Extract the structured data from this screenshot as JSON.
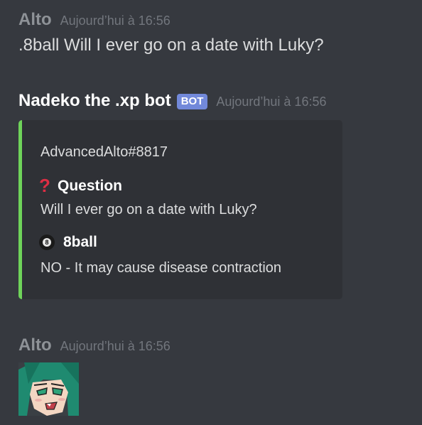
{
  "messages": [
    {
      "author": "Alto",
      "timestamp": "Aujourd’hui à 16:56",
      "text": ".8ball Will I ever go on a date with Luky?"
    },
    {
      "author": "Nadeko the .xp bot",
      "bot_tag": "BOT",
      "timestamp": "Aujourd’hui à 16:56",
      "embed": {
        "author": "AdvancedAlto#8817",
        "accent_color": "#6fd35a",
        "fields": [
          {
            "icon": "question-mark-icon",
            "name": "Question",
            "value": "Will I ever go on a date with Luky?"
          },
          {
            "icon": "8ball-icon",
            "name": "8ball",
            "value": "NO - It may cause disease contraction"
          }
        ]
      }
    },
    {
      "author": "Alto",
      "timestamp": "Aujourd’hui à 16:56",
      "image": "anime-girl-image"
    }
  ],
  "colors": {
    "background": "#36393f",
    "embed_background": "#2f3136",
    "bot_tag": "#7289da"
  }
}
